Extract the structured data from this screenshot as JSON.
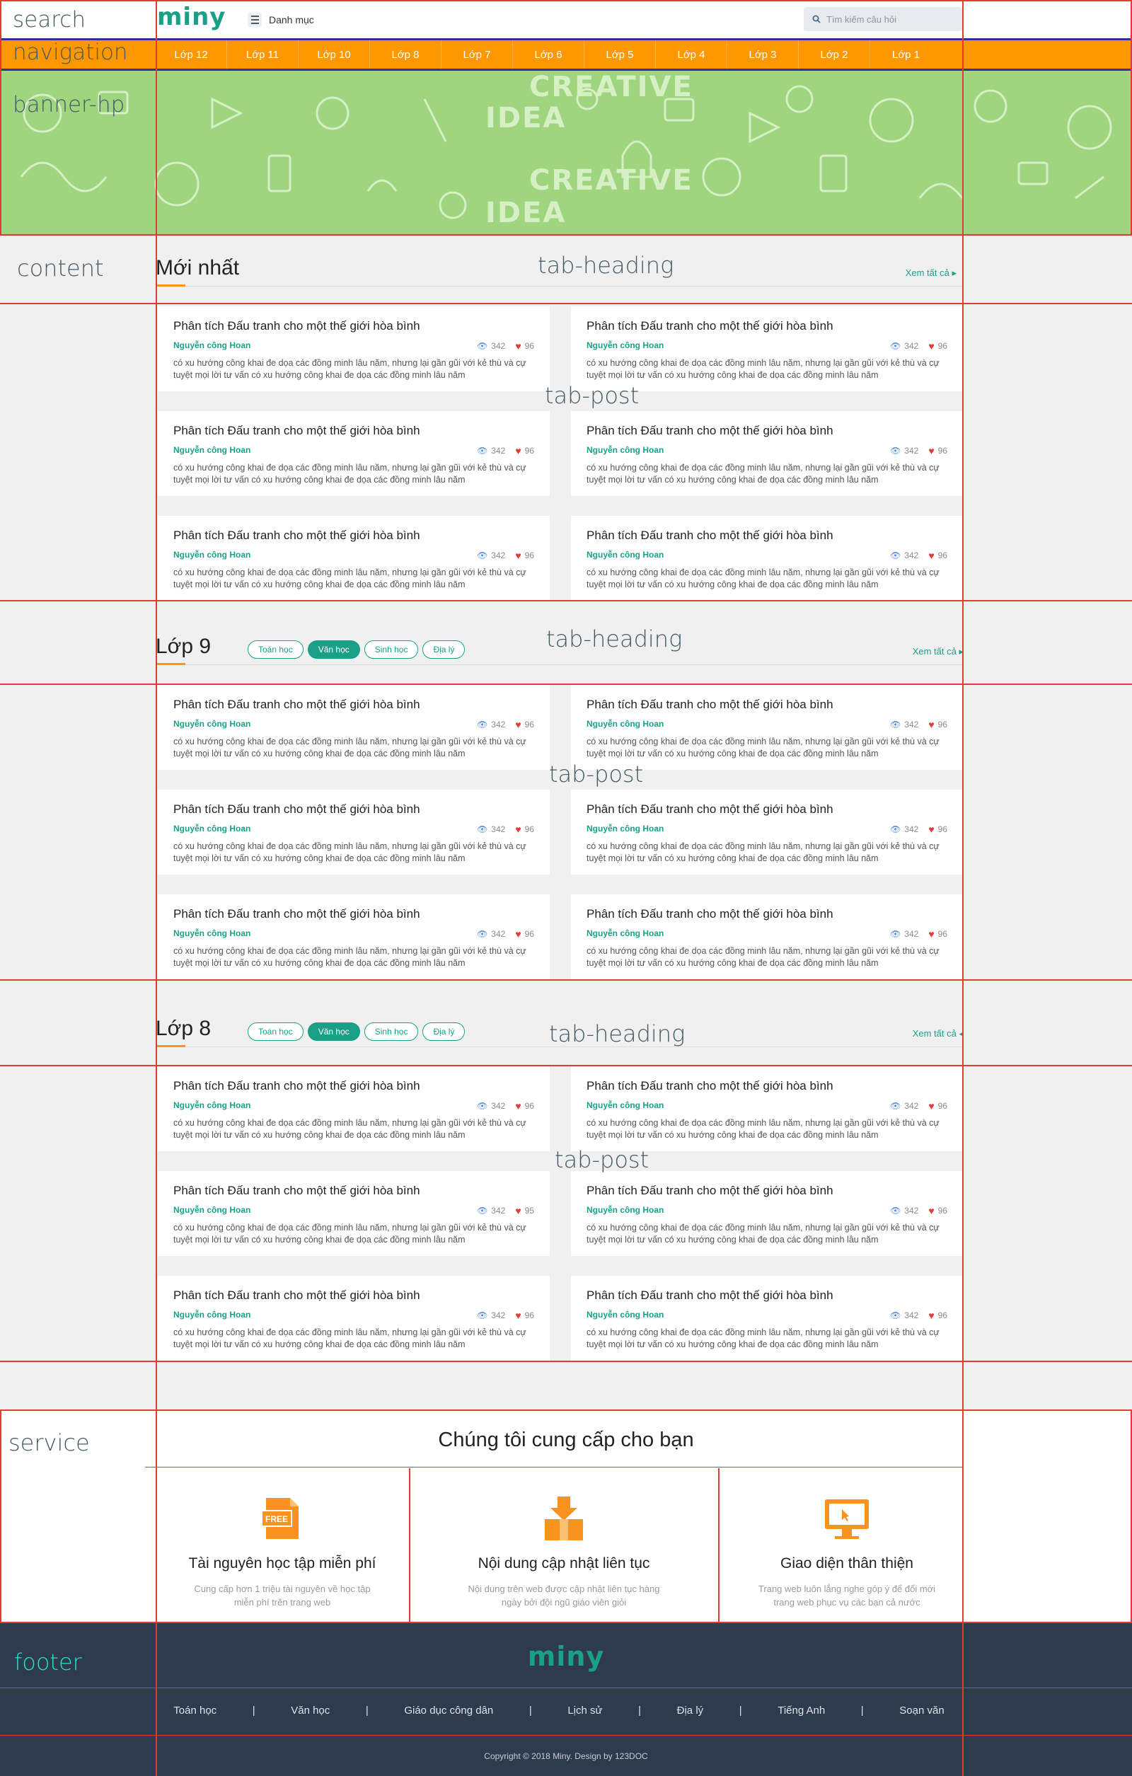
{
  "labels": {
    "search": "search",
    "navigation": "navigation",
    "banner": "banner-hp",
    "content": "content",
    "tab_heading": "tab-heading",
    "tab_post": "tab-post",
    "service": "service",
    "footer": "footer"
  },
  "header": {
    "logo": "miny",
    "menu_label": "Danh mục",
    "search_placeholder": "Tìm kiếm câu hỏi"
  },
  "nav": {
    "items": [
      "Lớp 12",
      "Lớp 11",
      "Lớp 10",
      "Lớp 8",
      "Lớp 7",
      "Lớp 6",
      "Lớp 5",
      "Lớp 4",
      "Lớp 3",
      "Lớp 2",
      "Lớp 1"
    ]
  },
  "banner": {
    "words": [
      "CREATIVE",
      "IDEA",
      "CREATIVE",
      "IDEA"
    ]
  },
  "sections": [
    {
      "title": "Mới nhất",
      "see_all": "Xem tất cả ▸",
      "pills": [],
      "cards": [
        {
          "title": "Phân tích Đấu tranh cho một thế giới hòa bình",
          "author": "Nguyễn công Hoan",
          "views": "342",
          "likes": "96",
          "desc": "có xu hướng công khai đe dọa các đồng minh lâu năm, nhưng lại gần gũi với kẻ thù và cự tuyệt mọi lời tư vấn có xu hướng công khai đe dọa các đồng minh lâu năm"
        },
        {
          "title": "Phân tích Đấu tranh cho một thế giới hòa bình",
          "author": "Nguyễn công Hoan",
          "views": "342",
          "likes": "96",
          "desc": "có xu hướng công khai đe dọa các đồng minh lâu năm, nhưng lại gần gũi với kẻ thù và cự tuyệt mọi lời tư vấn có xu hướng công khai đe dọa các đồng minh lâu năm"
        },
        {
          "title": "Phân tích Đấu tranh cho một thế giới hòa bình",
          "author": "Nguyễn công Hoan",
          "views": "342",
          "likes": "96",
          "desc": "có xu hướng công khai đe dọa các đồng minh lâu năm, nhưng lại gần gũi với kẻ thù và cự tuyệt mọi lời tư vấn có xu hướng công khai đe dọa các đồng minh lâu năm"
        },
        {
          "title": "Phân tích Đấu tranh cho một thế giới hòa bình",
          "author": "Nguyễn công Hoan",
          "views": "342",
          "likes": "96",
          "desc": "có xu hướng công khai đe dọa các đồng minh lâu năm, nhưng lại gần gũi với kẻ thù và cự tuyệt mọi lời tư vấn có xu hướng công khai đe dọa các đồng minh lâu năm"
        },
        {
          "title": "Phân tích Đấu tranh cho một thế giới hòa bình",
          "author": "Nguyễn công Hoan",
          "views": "342",
          "likes": "96",
          "desc": "có xu hướng công khai đe dọa các đồng minh lâu năm, nhưng lại gần gũi với kẻ thù và cự tuyệt mọi lời tư vấn có xu hướng công khai đe dọa các đồng minh lâu năm"
        },
        {
          "title": "Phân tích Đấu tranh cho một thế giới hòa bình",
          "author": "Nguyễn công Hoan",
          "views": "342",
          "likes": "96",
          "desc": "có xu hướng công khai đe dọa các đồng minh lâu năm, nhưng lại gần gũi với kẻ thù và cự tuyệt mọi lời tư vấn có xu hướng công khai đe dọa các đồng minh lâu năm"
        }
      ]
    },
    {
      "title": "Lớp 9",
      "see_all": "Xem tất cả ▸",
      "pills": [
        "Toán học",
        "Văn học",
        "Sinh học",
        "Địa lý"
      ],
      "active_pill": 1,
      "cards": [
        {
          "title": "Phân tích Đấu tranh cho một thế giới hòa bình",
          "author": "Nguyễn công Hoan",
          "views": "342",
          "likes": "96",
          "desc": "có xu hướng công khai đe dọa các đồng minh lâu năm, nhưng lại gần gũi với kẻ thù và cự tuyệt mọi lời tư vấn có xu hướng công khai đe dọa các đồng minh lâu năm"
        },
        {
          "title": "Phân tích Đấu tranh cho một thế giới hòa bình",
          "author": "Nguyễn công Hoan",
          "views": "342",
          "likes": "96",
          "desc": "có xu hướng công khai đe dọa các đồng minh lâu năm, nhưng lại gần gũi với kẻ thù và cự tuyệt mọi lời tư vấn có xu hướng công khai đe dọa các đồng minh lâu năm"
        },
        {
          "title": "Phân tích Đấu tranh cho một thế giới hòa bình",
          "author": "Nguyễn công Hoan",
          "views": "342",
          "likes": "96",
          "desc": "có xu hướng công khai đe dọa các đồng minh lâu năm, nhưng lại gần gũi với kẻ thù và cự tuyệt mọi lời tư vấn có xu hướng công khai đe dọa các đồng minh lâu năm"
        },
        {
          "title": "Phân tích Đấu tranh cho một thế giới hòa bình",
          "author": "Nguyễn công Hoan",
          "views": "342",
          "likes": "96",
          "desc": "có xu hướng công khai đe dọa các đồng minh lâu năm, nhưng lại gần gũi với kẻ thù và cự tuyệt mọi lời tư vấn có xu hướng công khai đe dọa các đồng minh lâu năm"
        },
        {
          "title": "Phân tích Đấu tranh cho một thế giới hòa bình",
          "author": "Nguyễn công Hoan",
          "views": "342",
          "likes": "96",
          "desc": "có xu hướng công khai đe dọa các đồng minh lâu năm, nhưng lại gần gũi với kẻ thù và cự tuyệt mọi lời tư vấn có xu hướng công khai đe dọa các đồng minh lâu năm"
        },
        {
          "title": "Phân tích Đấu tranh cho một thế giới hòa bình",
          "author": "Nguyễn công Hoan",
          "views": "342",
          "likes": "96",
          "desc": "có xu hướng công khai đe dọa các đồng minh lâu năm, nhưng lại gần gũi với kẻ thù và cự tuyệt mọi lời tư vấn có xu hướng công khai đe dọa các đồng minh lâu năm"
        }
      ]
    },
    {
      "title": "Lớp 8",
      "see_all": "Xem tất cả ◂",
      "pills": [
        "Toán học",
        "Văn học",
        "Sinh học",
        "Địa lý"
      ],
      "active_pill": 1,
      "cards": [
        {
          "title": "Phân tích Đấu tranh cho một thế giới hòa bình",
          "author": "Nguyễn công Hoan",
          "views": "342",
          "likes": "96",
          "desc": "có xu hướng công khai đe dọa các đồng minh lâu năm, nhưng lại gần gũi với kẻ thù và cự tuyệt mọi lời tư vấn có xu hướng công khai đe dọa các đồng minh lâu năm"
        },
        {
          "title": "Phân tích Đấu tranh cho một thế giới hòa bình",
          "author": "Nguyễn công Hoan",
          "views": "342",
          "likes": "96",
          "desc": "có xu hướng công khai đe dọa các đồng minh lâu năm, nhưng lại gần gũi với kẻ thù và cự tuyệt mọi lời tư vấn có xu hướng công khai đe dọa các đồng minh lâu năm"
        },
        {
          "title": "Phân tích Đấu tranh cho một thế giới hòa bình",
          "author": "Nguyễn công Hoan",
          "views": "342",
          "likes": "95",
          "desc": "có xu hướng công khai đe dọa các đồng minh lâu năm, nhưng lại gần gũi với kẻ thù và cự tuyệt mọi lời tư vấn có xu hướng công khai đe dọa các đồng minh lâu năm"
        },
        {
          "title": "Phân tích Đấu tranh cho một thế giới hòa bình",
          "author": "Nguyễn công Hoan",
          "views": "342",
          "likes": "96",
          "desc": "có xu hướng công khai đe dọa các đồng minh lâu năm, nhưng lại gần gũi với kẻ thù và cự tuyệt mọi lời tư vấn có xu hướng công khai đe dọa các đồng minh lâu năm"
        },
        {
          "title": "Phân tích Đấu tranh cho một thế giới hòa bình",
          "author": "Nguyễn công Hoan",
          "views": "342",
          "likes": "96",
          "desc": "có xu hướng công khai đe dọa các đồng minh lâu năm, nhưng lại gần gũi với kẻ thù và cự tuyệt mọi lời tư vấn có xu hướng công khai đe dọa các đồng minh lâu năm"
        },
        {
          "title": "Phân tích Đấu tranh cho một thế giới hòa bình",
          "author": "Nguyễn công Hoan",
          "views": "342",
          "likes": "96",
          "desc": "có xu hướng công khai đe dọa các đồng minh lâu năm, nhưng lại gần gũi với kẻ thù và cự tuyệt mọi lời tư vấn có xu hướng công khai đe dọa các đồng minh lâu năm"
        }
      ]
    }
  ],
  "service": {
    "title": "Chúng tôi cung cấp cho bạn",
    "items": [
      {
        "icon": "free-file-icon",
        "badge": "FREE",
        "title": "Tài nguyên học tập miễn phí",
        "desc": "Cung cấp hơn 1 triệu tài nguyên về học tập miễn phí trên trang web"
      },
      {
        "icon": "box-download-icon",
        "title": "Nội dung cập nhật liên tục",
        "desc": "Nội dung trên web được cập nhật liên tục hàng ngày bởi đội ngũ giáo viên giỏi"
      },
      {
        "icon": "monitor-icon",
        "title": "Giao diện thân thiện",
        "desc": "Trang web luôn lắng nghe góp ý để đổi mới trang web phục vụ các bạn cả nước"
      }
    ]
  },
  "footer": {
    "logo": "miny",
    "links": [
      "Toán học",
      "Văn học",
      "Giáo dục công dân",
      "Lịch sử",
      "Địa lý",
      "Tiếng Anh",
      "Soạn văn"
    ],
    "separator": "|",
    "copyright": "Copyright © 2018 Miny. Design by 123DOC"
  },
  "colors": {
    "accent": "#1aa087",
    "nav": "#ff9800",
    "banner": "#9ed57e",
    "footer": "#2e3a4d",
    "guides": "#e53935"
  }
}
